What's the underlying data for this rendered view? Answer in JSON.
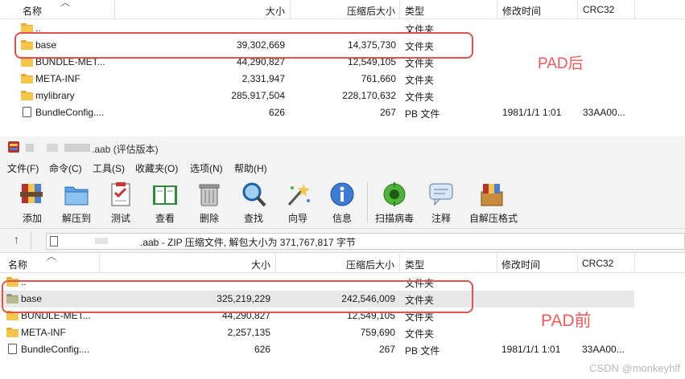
{
  "top_pane": {
    "columns": {
      "name": "名称",
      "size": "大小",
      "packed": "压缩后大小",
      "type": "类型",
      "modified": "修改时间",
      "crc": "CRC32"
    },
    "rows": [
      {
        "icon": "folder-icon",
        "name": "..",
        "size": "",
        "packed": "",
        "type": "文件夹",
        "modified": "",
        "crc": ""
      },
      {
        "icon": "folder-icon",
        "name": "base",
        "size": "39,302,669",
        "packed": "14,375,730",
        "type": "文件夹",
        "modified": "",
        "crc": ""
      },
      {
        "icon": "folder-icon",
        "name": "BUNDLE-MET...",
        "size": "44,290,827",
        "packed": "12,549,105",
        "type": "文件夹",
        "modified": "",
        "crc": ""
      },
      {
        "icon": "folder-icon",
        "name": "META-INF",
        "size": "2,331,947",
        "packed": "761,660",
        "type": "文件夹",
        "modified": "",
        "crc": ""
      },
      {
        "icon": "folder-icon",
        "name": "mylibrary",
        "size": "285,917,504",
        "packed": "228,170,632",
        "type": "文件夹",
        "modified": "",
        "crc": ""
      },
      {
        "icon": "file-icon",
        "name": "BundleConfig....",
        "size": "626",
        "packed": "267",
        "type": "PB 文件",
        "modified": "1981/1/1 1:01",
        "crc": "33AA00..."
      }
    ],
    "annotation": "PAD后"
  },
  "window": {
    "title": ".aab (评估版本)",
    "menu": [
      "文件(F)",
      "命令(C)",
      "工具(S)",
      "收藏夹(O)",
      "选项(N)",
      "帮助(H)"
    ],
    "toolbar": [
      {
        "label": "添加",
        "icon": "add-archive-icon"
      },
      {
        "label": "解压到",
        "icon": "extract-to-icon"
      },
      {
        "label": "测试",
        "icon": "test-icon"
      },
      {
        "label": "查看",
        "icon": "view-book-icon"
      },
      {
        "label": "删除",
        "icon": "trash-icon"
      },
      {
        "label": "查找",
        "icon": "magnifier-icon"
      },
      {
        "label": "向导",
        "icon": "wizard-wand-icon"
      },
      {
        "label": "信息",
        "icon": "info-icon"
      },
      {
        "label": "扫描病毒",
        "icon": "virus-scan-icon"
      },
      {
        "label": "注释",
        "icon": "comment-icon"
      },
      {
        "label": "自解压格式",
        "icon": "sfx-box-icon"
      }
    ],
    "address": ".aab - ZIP 压缩文件, 解包大小为 371,767,817 字节"
  },
  "bottom_pane": {
    "columns": {
      "name": "名称",
      "size": "大小",
      "packed": "压缩后大小",
      "type": "类型",
      "modified": "修改时间",
      "crc": "CRC32"
    },
    "rows": [
      {
        "icon": "folder-icon",
        "name": "..",
        "size": "",
        "packed": "",
        "type": "文件夹",
        "modified": "",
        "crc": ""
      },
      {
        "icon": "folder-icon",
        "name": "base",
        "size": "325,219,229",
        "packed": "242,546,009",
        "type": "文件夹",
        "modified": "",
        "crc": ""
      },
      {
        "icon": "folder-icon",
        "name": "BUNDLE-MET...",
        "size": "44,290,827",
        "packed": "12,549,105",
        "type": "文件夹",
        "modified": "",
        "crc": ""
      },
      {
        "icon": "folder-icon",
        "name": "META-INF",
        "size": "2,257,135",
        "packed": "759,690",
        "type": "文件夹",
        "modified": "",
        "crc": ""
      },
      {
        "icon": "file-icon",
        "name": "BundleConfig....",
        "size": "626",
        "packed": "267",
        "type": "PB 文件",
        "modified": "1981/1/1 1:01",
        "crc": "33AA00..."
      }
    ],
    "annotation": "PAD前"
  },
  "watermark": "CSDN @monkeyhlf",
  "colors": {
    "highlight": "#e0544f",
    "annotation": "#ee5a5a",
    "folder": "#f6c64a",
    "selected_row": "#e8e8e8"
  }
}
